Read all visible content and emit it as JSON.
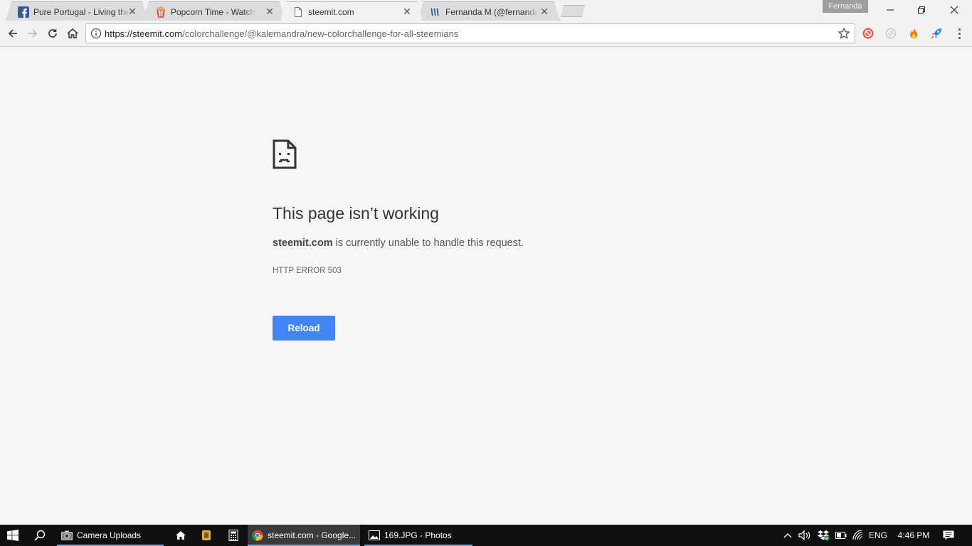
{
  "browser": {
    "profile_name": "Fernanda",
    "tabs": [
      {
        "title": "Pure Portugal - Living the",
        "favicon": "facebook-icon",
        "active": false
      },
      {
        "title": "Popcorn Time - Watch Si",
        "favicon": "popcorn-icon",
        "active": false
      },
      {
        "title": "steemit.com",
        "favicon": "page-icon",
        "active": true
      },
      {
        "title": "Fernanda M (@fernanda",
        "favicon": "steemit-icon",
        "active": false
      }
    ],
    "address": {
      "host": "https://steemit.com",
      "path": "/colorchallenge/@kalemandra/new-colorchallenge-for-all-steemians"
    },
    "extensions": [
      "blocker-icon",
      "disabled-blocker-icon",
      "flame-icon",
      "rocket-icon"
    ]
  },
  "error": {
    "title": "This page isn’t working",
    "host": "steemit.com",
    "description": " is currently unable to handle this request.",
    "code": "HTTP ERROR 503",
    "reload_label": "Reload"
  },
  "taskbar": {
    "apps": [
      {
        "label": "Camera Uploads",
        "icon": "camera-icon"
      },
      {
        "label": "steemit.com - Google...",
        "icon": "chrome-icon"
      },
      {
        "label": "169.JPG - Photos",
        "icon": "photos-icon"
      }
    ],
    "language": "ENG",
    "time": "4:46 PM"
  },
  "colors": {
    "accent": "#4285f4",
    "page_bg": "#f6f6f6",
    "taskbar_bg": "#101010"
  }
}
